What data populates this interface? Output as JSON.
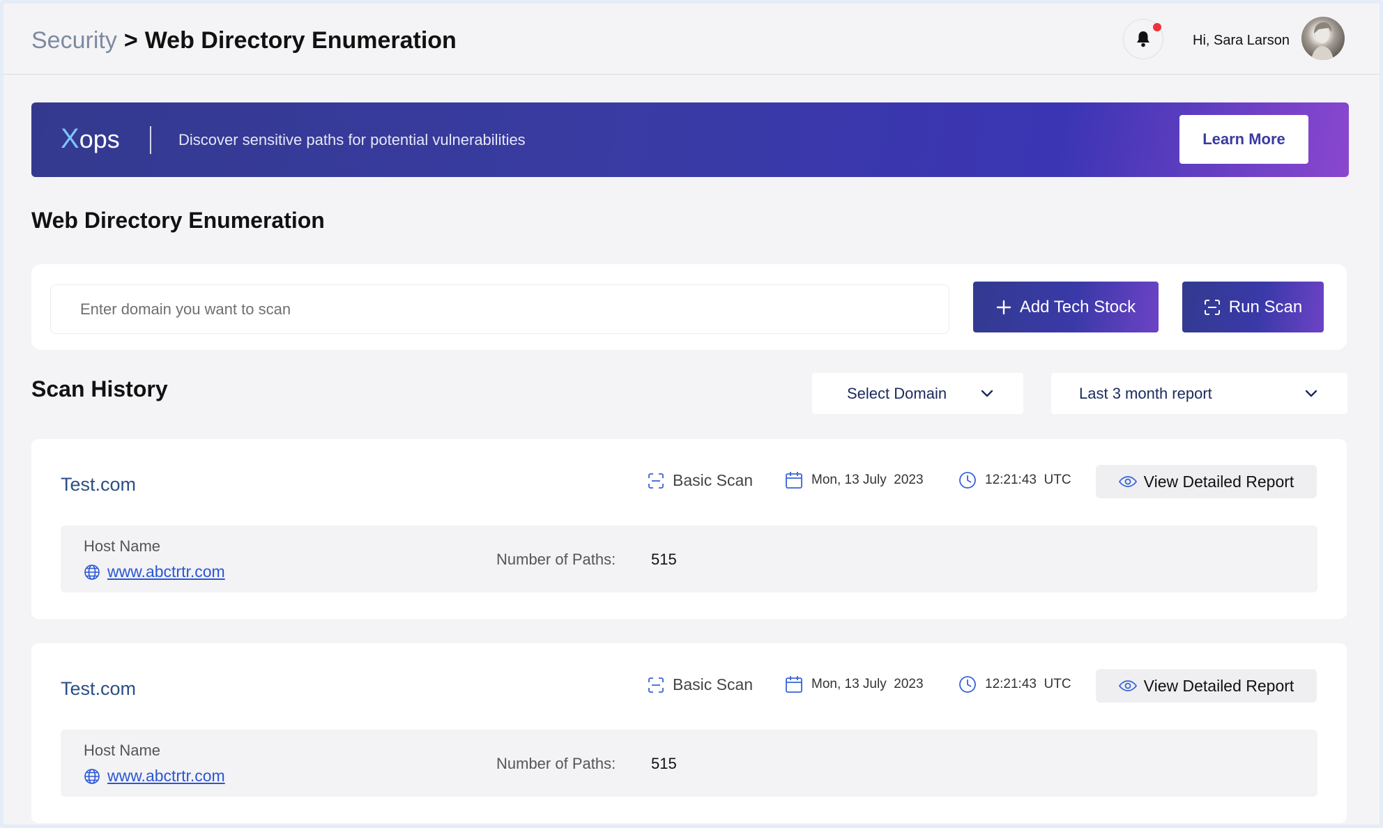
{
  "header": {
    "breadcrumb_parent": "Security",
    "breadcrumb_separator": ">",
    "breadcrumb_current": "Web Directory Enumeration",
    "greeting": "Hi, Sara Larson",
    "notification_dot_color": "#f0313a"
  },
  "banner": {
    "logo_x": "X",
    "logo_rest": "ops",
    "tagline": "Discover sensitive paths for potential vulnerabilities",
    "learn_more_label": "Learn More",
    "gradient_start": "#333a8e",
    "gradient_end": "#8a47cf"
  },
  "page_title": "Web Directory Enumeration",
  "scan_form": {
    "domain_placeholder": "Enter domain you want to scan",
    "add_tech_stock_label": "Add Tech Stock",
    "run_scan_label": "Run Scan"
  },
  "history": {
    "title": "Scan History",
    "select_domain_label": "Select Domain",
    "range_label": "Last 3 month report",
    "number_of_paths_label": "Number of Paths:",
    "host_name_label": "Host Name",
    "view_report_label": "View Detailed Report",
    "entries": [
      {
        "domain": "Test.com",
        "scan_type": "Basic Scan",
        "date": "Mon, 13 July  2023",
        "time": "12:21:43  UTC",
        "host": "www.abctrtr.com",
        "paths": "515"
      },
      {
        "domain": "Test.com",
        "scan_type": "Basic Scan",
        "date": "Mon, 13 July  2023",
        "time": "12:21:43  UTC",
        "host": "www.abctrtr.com",
        "paths": "515"
      }
    ]
  },
  "icons": {
    "bell": "bell-icon",
    "plus": "plus-icon",
    "scan": "scan-frame-icon",
    "calendar": "calendar-icon",
    "clock": "clock-icon",
    "eye": "eye-icon",
    "globe": "globe-icon",
    "chevron": "chevron-down-icon"
  }
}
